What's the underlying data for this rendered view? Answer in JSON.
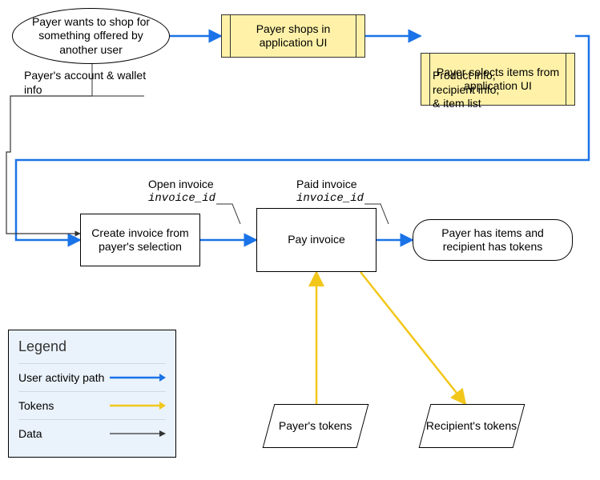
{
  "nodes": {
    "start": {
      "text": "Payer wants to shop for something offered by another user"
    },
    "shop": {
      "text": "Payer shops in application UI"
    },
    "select": {
      "text": "Payer selects items from application UI"
    },
    "createInv": {
      "text": "Create invoice from payer's selection"
    },
    "payInv": {
      "text": "Pay invoice"
    },
    "done": {
      "text": "Payer has items and recipient has tokens"
    },
    "payerTok": {
      "text": "Payer's tokens"
    },
    "recipTok": {
      "text": "Recipient's tokens"
    }
  },
  "annotations": {
    "accountWallet": {
      "text": "Payer's account & wallet info"
    },
    "productInfo": {
      "line1": "Product info,",
      "line2": "recipient info,",
      "line3": "& item list"
    },
    "openInvoice": {
      "line1": "Open invoice",
      "line2": "invoice_id"
    },
    "paidInvoice": {
      "line1": "Paid invoice",
      "line2": "invoice_id"
    }
  },
  "legend": {
    "title": "Legend",
    "rows": {
      "user": {
        "label": "User activity path",
        "color": "#1a73e8"
      },
      "tokens": {
        "label": "Tokens",
        "color": "#f2c71a"
      },
      "data": {
        "label": "Data",
        "color": "#333333"
      }
    }
  },
  "chart_data": {
    "type": "flowchart",
    "nodes": [
      {
        "id": "start",
        "shape": "ellipse",
        "label": "Payer wants to shop for something offered by another user"
      },
      {
        "id": "shop",
        "shape": "process-yellow",
        "label": "Payer shops in application UI"
      },
      {
        "id": "select",
        "shape": "process-yellow",
        "label": "Payer selects items from application UI"
      },
      {
        "id": "createInv",
        "shape": "process",
        "label": "Create invoice from payer's selection"
      },
      {
        "id": "payInv",
        "shape": "process",
        "label": "Pay invoice"
      },
      {
        "id": "done",
        "shape": "terminator",
        "label": "Payer has items and recipient has tokens"
      },
      {
        "id": "payerTok",
        "shape": "data",
        "label": "Payer's tokens"
      },
      {
        "id": "recipTok",
        "shape": "data",
        "label": "Recipient's tokens"
      }
    ],
    "edges": [
      {
        "from": "start",
        "to": "shop",
        "kind": "user"
      },
      {
        "from": "shop",
        "to": "select",
        "kind": "user"
      },
      {
        "from": "select",
        "to": "createInv",
        "kind": "user",
        "annotation": "Product info, recipient info, & item list"
      },
      {
        "from": "createInv",
        "to": "payInv",
        "kind": "user",
        "annotation": "Open invoice invoice_id"
      },
      {
        "from": "payInv",
        "to": "done",
        "kind": "user",
        "annotation": "Paid invoice invoice_id"
      },
      {
        "from": "start",
        "to": "createInv",
        "kind": "data",
        "annotation": "Payer's account & wallet info"
      },
      {
        "from": "payerTok",
        "to": "payInv",
        "kind": "tokens"
      },
      {
        "from": "payInv",
        "to": "recipTok",
        "kind": "tokens"
      }
    ],
    "legend": [
      {
        "label": "User activity path",
        "kind": "user",
        "color": "#1a73e8"
      },
      {
        "label": "Tokens",
        "kind": "tokens",
        "color": "#f2c71a"
      },
      {
        "label": "Data",
        "kind": "data",
        "color": "#333333"
      }
    ]
  }
}
